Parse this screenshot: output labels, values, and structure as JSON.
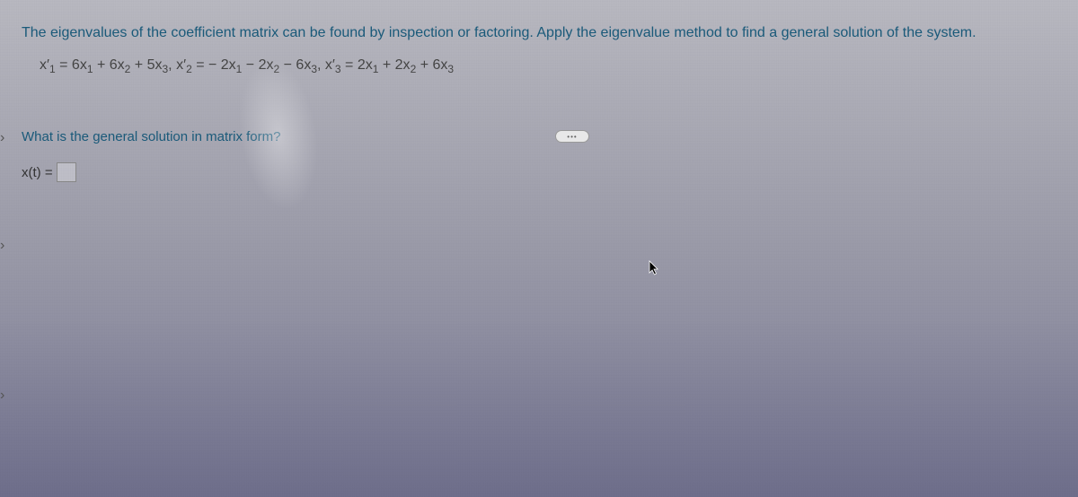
{
  "instruction": "The eigenvalues of the coefficient matrix can be found by inspection or factoring. Apply the eigenvalue method to find a general solution of the system.",
  "equation_html": "x′<sub>1</sub> = 6x<sub>1</sub> + 6x<sub>2</sub> + 5x<sub>3</sub>, x′<sub>2</sub> = − 2x<sub>1</sub> − 2x<sub>2</sub> − 6x<sub>3</sub>, x′<sub>3</sub> = 2x<sub>1</sub> + 2x<sub>2</sub> + 6x<sub>3</sub>",
  "more_label": "•••",
  "question": "What is the general solution in matrix form?",
  "answer_prefix": "x(t) =",
  "carets": "›"
}
